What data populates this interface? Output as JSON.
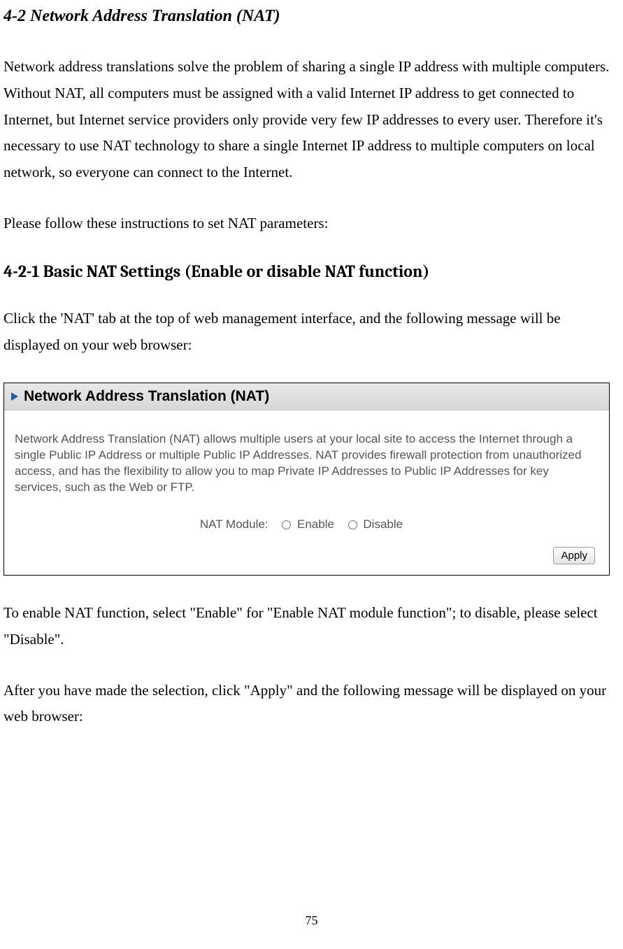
{
  "heading1": "4-2 Network Address Translation (NAT)",
  "para1": "Network address translations solve the problem of sharing a single IP address with multiple computers. Without NAT, all computers must be assigned with a valid Internet IP address to get connected to Internet, but Internet service providers only provide very few IP addresses to every user. Therefore it's necessary to use NAT technology to share a single Internet IP address to multiple computers on local network, so everyone can connect to the Internet.",
  "para2": "Please follow these instructions to set NAT parameters:",
  "heading2": "4-2-1 Basic NAT Settings (Enable or disable NAT function)",
  "para3": "Click the 'NAT' tab at the top of web management interface, and the following message will be displayed on your web browser:",
  "screenshot": {
    "title": "Network Address Translation (NAT)",
    "description": "Network Address Translation (NAT) allows multiple users at your local site to access the Internet through a single Public IP Address or multiple Public IP Addresses. NAT provides firewall protection from unauthorized access, and has the flexibility to allow you to map Private IP Addresses to Public IP Addresses for key services, such as the Web or FTP.",
    "moduleLabel": "NAT Module:",
    "enableLabel": "Enable",
    "disableLabel": "Disable",
    "applyLabel": "Apply"
  },
  "para4": "To enable NAT function, select \"Enable\" for \"Enable NAT module function\"; to disable, please select \"Disable\".",
  "para5": "After you have made the selection, click \"Apply\" and the following message will be displayed on your web browser:",
  "pageNumber": "75"
}
